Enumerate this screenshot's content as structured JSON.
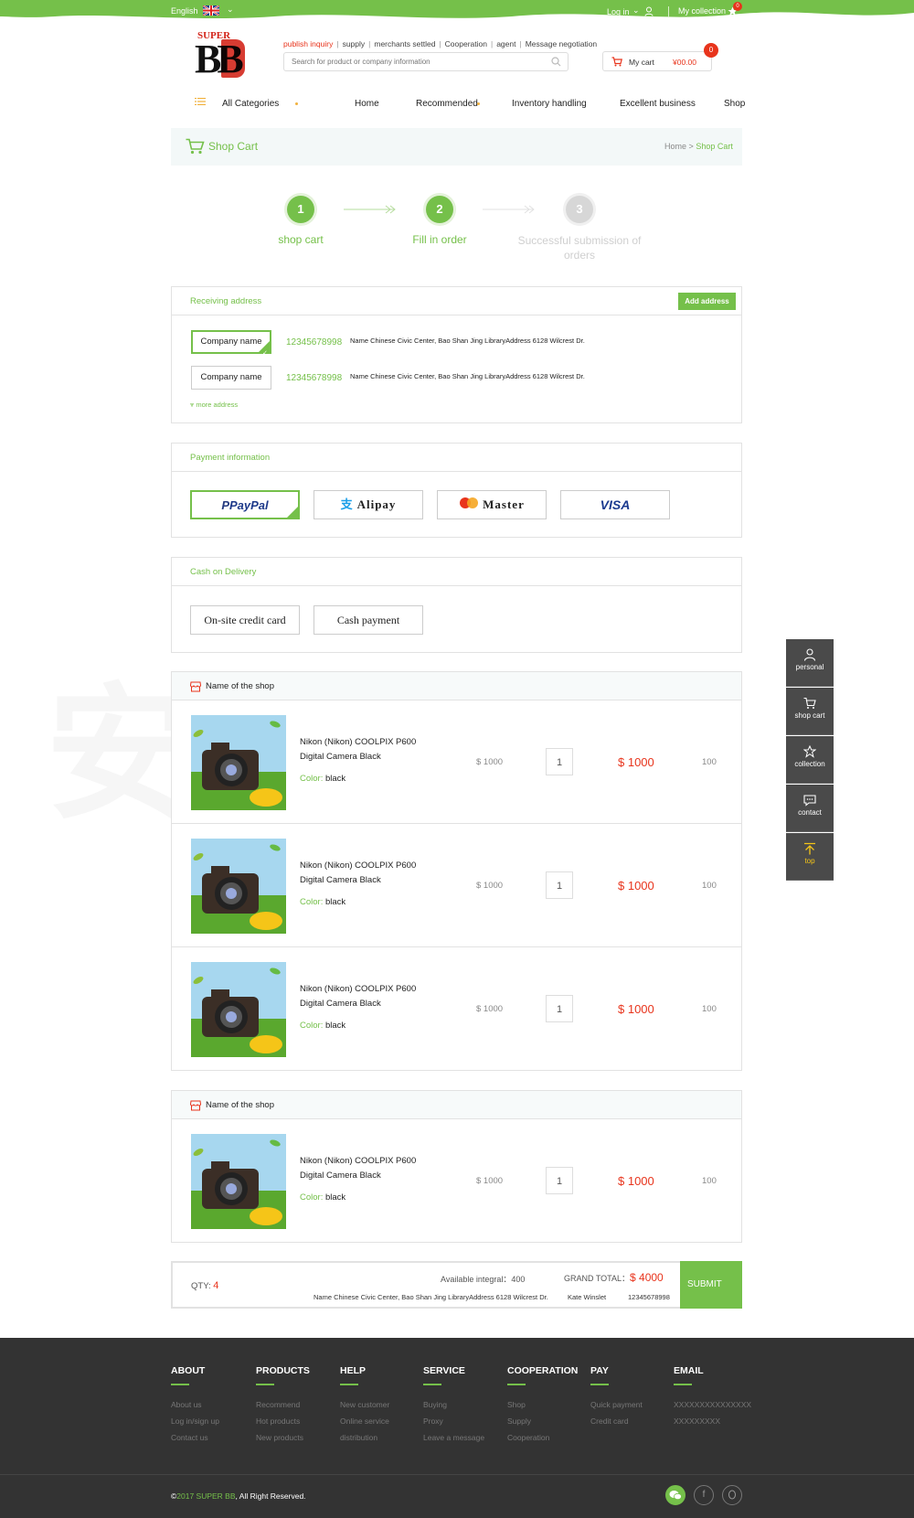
{
  "topbar": {
    "language": "English",
    "login": "Log in",
    "collection": "My collection",
    "collection_count": "0"
  },
  "header": {
    "logo_top": "SUPER",
    "logo_main": "BB",
    "quicklinks": [
      "publish inquiry",
      "supply",
      "merchants settled",
      "Cooperation",
      "agent",
      "Message negotiation"
    ],
    "search_placeholder": "Search for product or company information",
    "cart_label": "My cart",
    "cart_amount": "¥00.00",
    "cart_count": "0"
  },
  "nav": {
    "all_categories": "All Categories",
    "items": [
      "Home",
      "Recommended",
      "Inventory handling",
      "Excellent business",
      "Shop"
    ]
  },
  "banner": {
    "title": "Shop Cart",
    "crumb_home": "Home",
    "crumb_sep": ">",
    "crumb_current": "Shop Cart"
  },
  "steps": [
    {
      "num": "1",
      "label": "shop cart"
    },
    {
      "num": "2",
      "label": "Fill in order"
    },
    {
      "num": "3",
      "label": "Successful submission of orders"
    }
  ],
  "address": {
    "title": "Receiving address",
    "add_button": "Add address",
    "entries": [
      {
        "name": "Company name",
        "phone": "12345678998",
        "detail": "Name Chinese Civic Center, Bao Shan Jing LibraryAddress 6128 Wilcrest Dr."
      },
      {
        "name": "Company name",
        "phone": "12345678998",
        "detail": "Name Chinese Civic Center, Bao Shan Jing LibraryAddress 6128 Wilcrest Dr."
      }
    ],
    "more": "more address"
  },
  "payment": {
    "title": "Payment information",
    "methods": [
      "PayPal",
      "Alipay",
      "Master",
      "VISA"
    ]
  },
  "cod": {
    "title": "Cash on Delivery",
    "options": [
      "On-site credit card",
      "Cash payment"
    ]
  },
  "shops": [
    {
      "name": "Name of the shop",
      "items": [
        {
          "title": "Nikon (Nikon) COOLPIX P600 Digital Camera Black",
          "color_label": "Color:",
          "color": "black",
          "price": "$ 1000",
          "qty": "1",
          "total": "$ 1000",
          "stock": "100"
        },
        {
          "title": "Nikon (Nikon) COOLPIX P600 Digital Camera Black",
          "color_label": "Color:",
          "color": "black",
          "price": "$ 1000",
          "qty": "1",
          "total": "$ 1000",
          "stock": "100"
        },
        {
          "title": "Nikon (Nikon) COOLPIX P600 Digital Camera Black",
          "color_label": "Color:",
          "color": "black",
          "price": "$ 1000",
          "qty": "1",
          "total": "$ 1000",
          "stock": "100"
        }
      ]
    },
    {
      "name": "Name of the shop",
      "items": [
        {
          "title": "Nikon (Nikon) COOLPIX P600 Digital Camera Black",
          "color_label": "Color:",
          "color": "black",
          "price": "$ 1000",
          "qty": "1",
          "total": "$ 1000",
          "stock": "100"
        }
      ]
    }
  ],
  "summary": {
    "qty_label": "QTY:",
    "qty": "4",
    "integral_label": "Available integral：",
    "integral": "400",
    "grand_label": "GRAND TOTAL：",
    "grand_total": "$ 4000",
    "address": "Name Chinese Civic Center, Bao Shan Jing LibraryAddress 6128 Wilcrest Dr.",
    "receiver": "Kate Winslet",
    "phone": "12345678998",
    "submit": "SUBMIT"
  },
  "sidebar": [
    "personal",
    "shop cart",
    "collection",
    "contact",
    "top"
  ],
  "footer": {
    "columns": [
      {
        "title": "ABOUT",
        "links": [
          "About us",
          "Log in/sign up",
          "Contact us"
        ]
      },
      {
        "title": "PRODUCTS",
        "links": [
          "Recommend",
          "Hot products",
          "New products"
        ]
      },
      {
        "title": "HELP",
        "links": [
          "New customer",
          "Online service",
          "distribution"
        ]
      },
      {
        "title": "SERVICE",
        "links": [
          "Buying",
          "Proxy",
          "Leave a message"
        ]
      },
      {
        "title": "COOPERATION",
        "links": [
          "Shop",
          "Supply",
          "Cooperation"
        ]
      },
      {
        "title": "PAY",
        "links": [
          "Quick payment",
          "Credit card"
        ]
      },
      {
        "title": "EMAIL",
        "links": [
          "XXXXXXXXXXXXXXX",
          "XXXXXXXXX"
        ]
      }
    ],
    "copyright_prefix": "©",
    "copyright_year": "2017 SUPER BB",
    "copyright_suffix": ", All Right Reserved."
  },
  "colors": {
    "accent": "#75c04a",
    "price_red": "#e8341c",
    "footer_bg": "#333333",
    "sidebar_bg": "#4a4a4a"
  }
}
